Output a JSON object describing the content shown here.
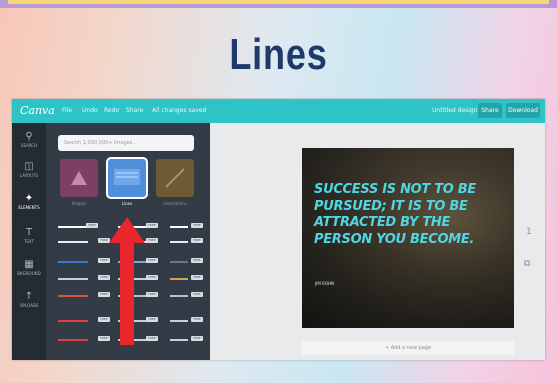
{
  "slide": {
    "title": "Lines"
  },
  "app": {
    "logo": "Canva",
    "menu": [
      "File",
      "Undo",
      "Redo",
      "Share",
      "All changes saved"
    ],
    "doc_title": "Untitled design",
    "share_label": "Share",
    "download_label": "Download"
  },
  "left_rail": [
    {
      "label": "SEARCH",
      "icon": "search-icon"
    },
    {
      "label": "LAYOUTS",
      "icon": "layouts-icon"
    },
    {
      "label": "ELEMENTS",
      "icon": "elements-icon"
    },
    {
      "label": "TEXT",
      "icon": "text-icon"
    },
    {
      "label": "BKGROUND",
      "icon": "background-icon"
    },
    {
      "label": "UPLOADS",
      "icon": "uploads-icon"
    }
  ],
  "panel": {
    "search_placeholder": "Search 1,000,000+ images...",
    "categories": [
      {
        "label": "Shapes",
        "color": "#7d3f63"
      },
      {
        "label": "Lines",
        "color": "#4f8ed9"
      },
      {
        "label": "Illustrations",
        "color": "#6e5a33"
      }
    ],
    "free_tag": "FREE"
  },
  "canvas": {
    "quote": "SUCCESS IS NOT TO BE PURSUED; IT IS TO BE ATTRACTED BY THE PERSON YOU BECOME.",
    "author": "JIM ROHN",
    "add_page": "+ Add a new page",
    "page_number": "1"
  },
  "colors": {
    "topbar": "#2ec3c6",
    "accent_arrow": "#e8262b",
    "quote_text": "#4fd6e3"
  }
}
